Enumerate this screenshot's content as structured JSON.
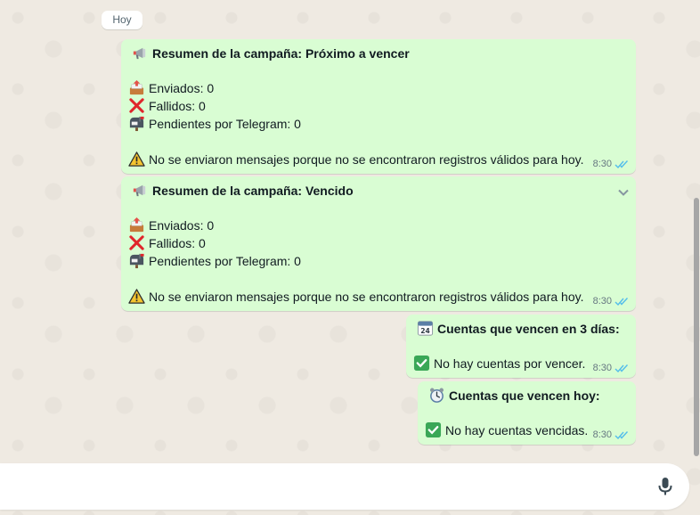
{
  "date_chip": "Hoy",
  "messages": [
    {
      "title": "Resumen de la campaña: Próximo a vencer",
      "sent": "Enviados: 0",
      "failed": "Fallidos: 0",
      "pending": "Pendientes por Telegram: 0",
      "warning": "No se enviaron mensajes porque no se encontraron registros válidos para hoy.",
      "time": "8:30"
    },
    {
      "title": "Resumen de la campaña: Vencido",
      "sent": "Enviados: 0",
      "failed": "Fallidos: 0",
      "pending": "Pendientes por Telegram: 0",
      "warning": "No se enviaron mensajes porque no se encontraron registros válidos para hoy.",
      "time": "8:30"
    },
    {
      "title": "Cuentas que vencen en 3 días:",
      "body": "No hay cuentas por vencer.",
      "time": "8:30",
      "calendar_day": "24"
    },
    {
      "title": "Cuentas que vencen hoy:",
      "body": "No hay cuentas vencidas.",
      "time": "8:30"
    }
  ],
  "composer": {
    "placeholder": ""
  },
  "icons": {
    "megaphone": "megaphone-icon",
    "outbox": "outbox-tray-icon",
    "cross": "cross-mark-icon",
    "mailbox": "mailbox-icon",
    "warning": "warning-icon",
    "calendar": "calendar-icon",
    "check": "check-mark-button-icon",
    "alarm": "alarm-clock-icon",
    "read_ticks": "double-check-icon",
    "mic": "microphone-icon",
    "chevron": "chevron-down-icon"
  },
  "colors": {
    "outgoing_bubble": "#d9fdd3",
    "wallpaper": "#efeae2",
    "read_tick": "#53bdeb",
    "meta_text": "#667781"
  }
}
